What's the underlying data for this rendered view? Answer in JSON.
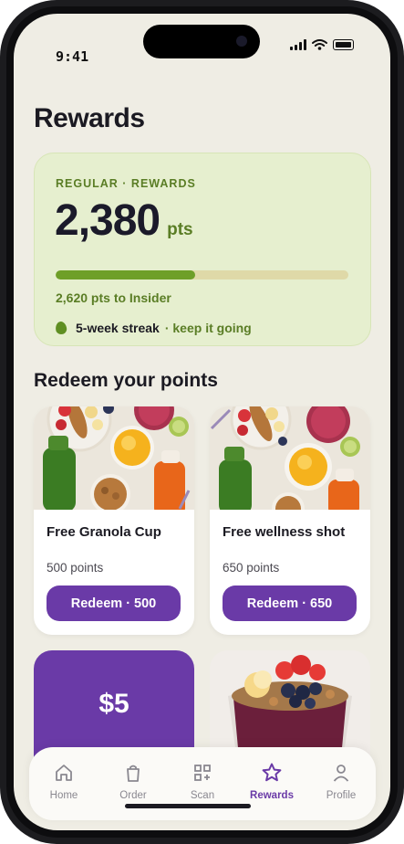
{
  "status": {
    "time": "9:41"
  },
  "page": {
    "title": "Rewards"
  },
  "points_card": {
    "tier": "REGULAR · REWARDS",
    "points": "2,380",
    "unit": "pts",
    "progress": 0.476,
    "to_next": "2,620 pts to Insider",
    "streak": "5-week streak",
    "streak_hint": "· keep it going"
  },
  "redeem": {
    "title": "Redeem your points",
    "rewards": [
      {
        "name": "Free Granola Cup",
        "cost": "500 points",
        "button": "Redeem · 500"
      },
      {
        "name": "Free wellness shot",
        "cost": "650 points",
        "button": "Redeem · 650"
      }
    ],
    "promo": {
      "amount": "$5"
    }
  },
  "tabs": [
    {
      "label": "Home",
      "icon": "home-icon"
    },
    {
      "label": "Order",
      "icon": "bag-icon"
    },
    {
      "label": "Scan",
      "icon": "scan-icon"
    },
    {
      "label": "Rewards",
      "icon": "star-icon",
      "active": true
    },
    {
      "label": "Profile",
      "icon": "person-icon"
    }
  ],
  "colors": {
    "accent": "#6a3aa7",
    "green": "#5a7d25",
    "background": "#efede4"
  }
}
